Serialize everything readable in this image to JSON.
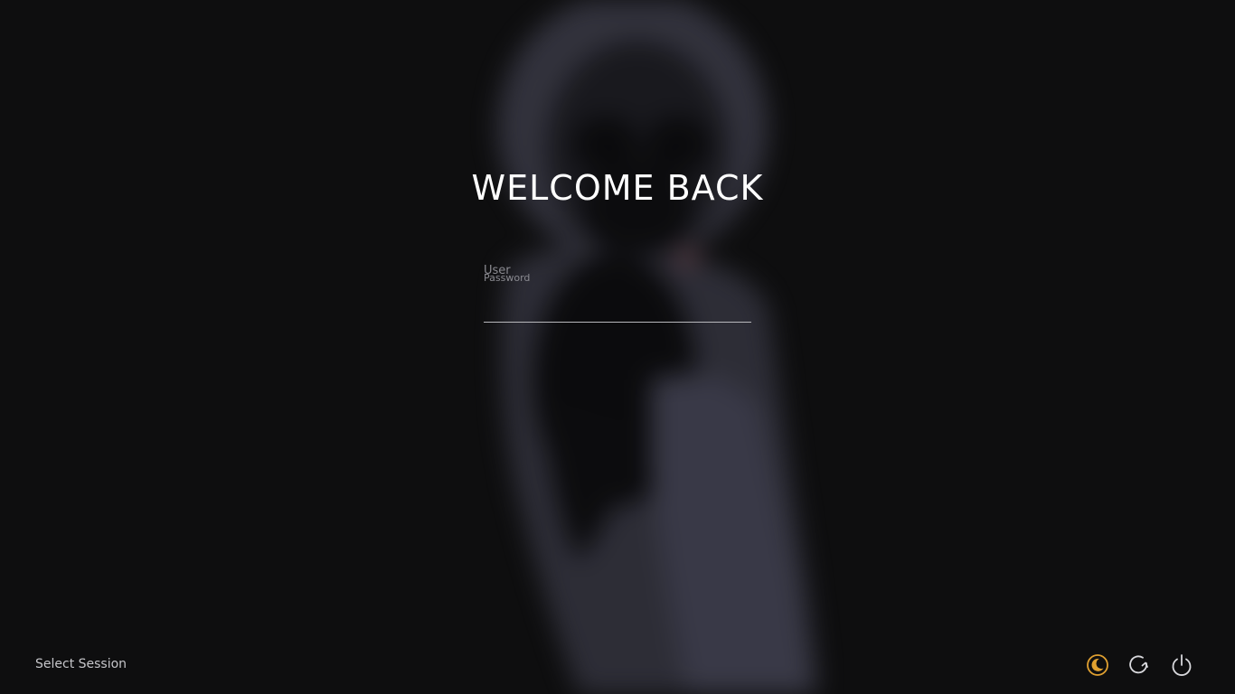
{
  "login": {
    "title": "WELCOME BACK",
    "user_label": "User",
    "password_label": "Password",
    "password_value": ""
  },
  "session": {
    "label": "Select Session"
  },
  "power": {
    "items": [
      {
        "icon": "moon-icon",
        "action": "suspend",
        "color": "#e0a030"
      },
      {
        "icon": "restart-icon",
        "action": "restart",
        "color": "#d8d8dc"
      },
      {
        "icon": "power-icon",
        "action": "shutdown",
        "color": "#d8d8dc"
      }
    ]
  },
  "colors": {
    "background": "#0e0e0f",
    "figure": "#3a3a48",
    "accent": "#e0a030",
    "text": "#ffffff"
  }
}
